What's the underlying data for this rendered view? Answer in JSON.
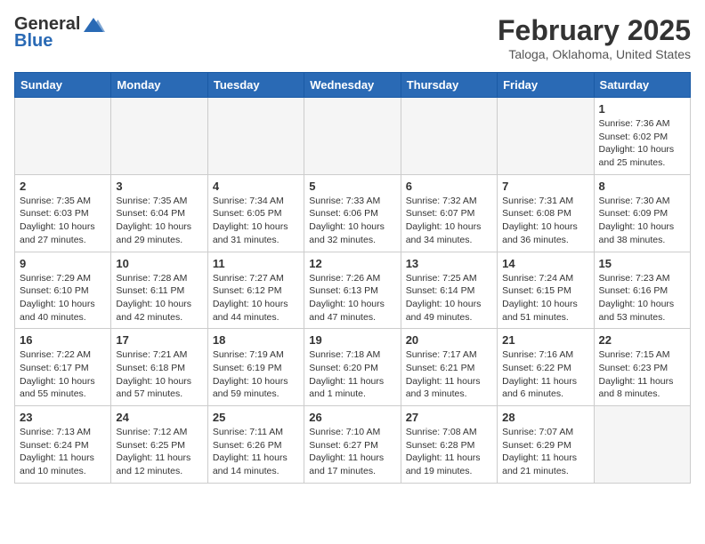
{
  "header": {
    "logo_general": "General",
    "logo_blue": "Blue",
    "title": "February 2025",
    "subtitle": "Taloga, Oklahoma, United States"
  },
  "days_of_week": [
    "Sunday",
    "Monday",
    "Tuesday",
    "Wednesday",
    "Thursday",
    "Friday",
    "Saturday"
  ],
  "weeks": [
    [
      {
        "day": "",
        "empty": true
      },
      {
        "day": "",
        "empty": true
      },
      {
        "day": "",
        "empty": true
      },
      {
        "day": "",
        "empty": true
      },
      {
        "day": "",
        "empty": true
      },
      {
        "day": "",
        "empty": true
      },
      {
        "day": "1",
        "sunrise": "7:36 AM",
        "sunset": "6:02 PM",
        "daylight": "10 hours and 25 minutes."
      }
    ],
    [
      {
        "day": "2",
        "sunrise": "7:35 AM",
        "sunset": "6:03 PM",
        "daylight": "10 hours and 27 minutes."
      },
      {
        "day": "3",
        "sunrise": "7:35 AM",
        "sunset": "6:04 PM",
        "daylight": "10 hours and 29 minutes."
      },
      {
        "day": "4",
        "sunrise": "7:34 AM",
        "sunset": "6:05 PM",
        "daylight": "10 hours and 31 minutes."
      },
      {
        "day": "5",
        "sunrise": "7:33 AM",
        "sunset": "6:06 PM",
        "daylight": "10 hours and 32 minutes."
      },
      {
        "day": "6",
        "sunrise": "7:32 AM",
        "sunset": "6:07 PM",
        "daylight": "10 hours and 34 minutes."
      },
      {
        "day": "7",
        "sunrise": "7:31 AM",
        "sunset": "6:08 PM",
        "daylight": "10 hours and 36 minutes."
      },
      {
        "day": "8",
        "sunrise": "7:30 AM",
        "sunset": "6:09 PM",
        "daylight": "10 hours and 38 minutes."
      }
    ],
    [
      {
        "day": "9",
        "sunrise": "7:29 AM",
        "sunset": "6:10 PM",
        "daylight": "10 hours and 40 minutes."
      },
      {
        "day": "10",
        "sunrise": "7:28 AM",
        "sunset": "6:11 PM",
        "daylight": "10 hours and 42 minutes."
      },
      {
        "day": "11",
        "sunrise": "7:27 AM",
        "sunset": "6:12 PM",
        "daylight": "10 hours and 44 minutes."
      },
      {
        "day": "12",
        "sunrise": "7:26 AM",
        "sunset": "6:13 PM",
        "daylight": "10 hours and 47 minutes."
      },
      {
        "day": "13",
        "sunrise": "7:25 AM",
        "sunset": "6:14 PM",
        "daylight": "10 hours and 49 minutes."
      },
      {
        "day": "14",
        "sunrise": "7:24 AM",
        "sunset": "6:15 PM",
        "daylight": "10 hours and 51 minutes."
      },
      {
        "day": "15",
        "sunrise": "7:23 AM",
        "sunset": "6:16 PM",
        "daylight": "10 hours and 53 minutes."
      }
    ],
    [
      {
        "day": "16",
        "sunrise": "7:22 AM",
        "sunset": "6:17 PM",
        "daylight": "10 hours and 55 minutes."
      },
      {
        "day": "17",
        "sunrise": "7:21 AM",
        "sunset": "6:18 PM",
        "daylight": "10 hours and 57 minutes."
      },
      {
        "day": "18",
        "sunrise": "7:19 AM",
        "sunset": "6:19 PM",
        "daylight": "10 hours and 59 minutes."
      },
      {
        "day": "19",
        "sunrise": "7:18 AM",
        "sunset": "6:20 PM",
        "daylight": "11 hours and 1 minute."
      },
      {
        "day": "20",
        "sunrise": "7:17 AM",
        "sunset": "6:21 PM",
        "daylight": "11 hours and 3 minutes."
      },
      {
        "day": "21",
        "sunrise": "7:16 AM",
        "sunset": "6:22 PM",
        "daylight": "11 hours and 6 minutes."
      },
      {
        "day": "22",
        "sunrise": "7:15 AM",
        "sunset": "6:23 PM",
        "daylight": "11 hours and 8 minutes."
      }
    ],
    [
      {
        "day": "23",
        "sunrise": "7:13 AM",
        "sunset": "6:24 PM",
        "daylight": "11 hours and 10 minutes."
      },
      {
        "day": "24",
        "sunrise": "7:12 AM",
        "sunset": "6:25 PM",
        "daylight": "11 hours and 12 minutes."
      },
      {
        "day": "25",
        "sunrise": "7:11 AM",
        "sunset": "6:26 PM",
        "daylight": "11 hours and 14 minutes."
      },
      {
        "day": "26",
        "sunrise": "7:10 AM",
        "sunset": "6:27 PM",
        "daylight": "11 hours and 17 minutes."
      },
      {
        "day": "27",
        "sunrise": "7:08 AM",
        "sunset": "6:28 PM",
        "daylight": "11 hours and 19 minutes."
      },
      {
        "day": "28",
        "sunrise": "7:07 AM",
        "sunset": "6:29 PM",
        "daylight": "11 hours and 21 minutes."
      },
      {
        "day": "",
        "empty": true
      }
    ]
  ],
  "labels": {
    "sunrise": "Sunrise:",
    "sunset": "Sunset:",
    "daylight": "Daylight:"
  }
}
